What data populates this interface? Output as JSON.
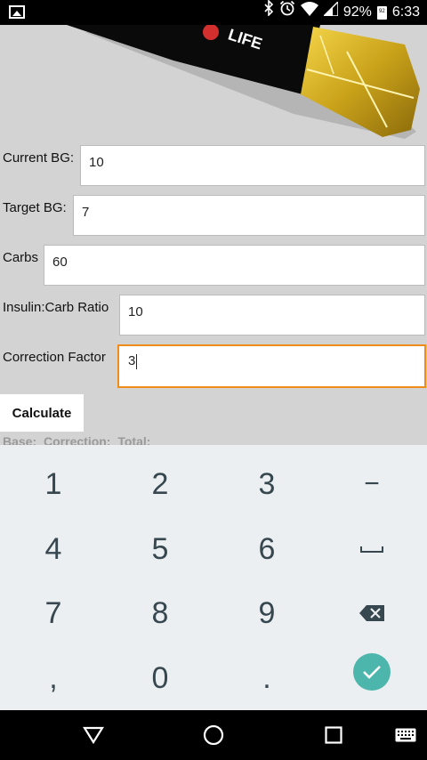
{
  "status_bar": {
    "battery_percent": "92%",
    "sim_badge": "92",
    "time": "6:33",
    "icons": [
      "gallery-icon",
      "bluetooth-icon",
      "alarm-icon",
      "wifi-icon",
      "signal-icon",
      "battery-icon"
    ]
  },
  "banner": {
    "logo_text": "LIFE"
  },
  "form": {
    "current_bg": {
      "label": "Current BG:",
      "value": "10"
    },
    "target_bg": {
      "label": "Target BG:",
      "value": "7"
    },
    "carbs": {
      "label": "Carbs",
      "value": "60"
    },
    "ratio": {
      "label": "Insulin:Carb Ratio",
      "value": "10"
    },
    "correction": {
      "label": "Correction Factor",
      "value": "3"
    }
  },
  "calculate_label": "Calculate",
  "results_text": "Base: Correction: Total:",
  "keyboard": {
    "keys": [
      "1",
      "2",
      "3",
      "−",
      "4",
      "5",
      "6",
      "␣",
      "7",
      "8",
      "9",
      "⌫",
      ",",
      "0",
      ".",
      "✓"
    ]
  },
  "colors": {
    "accent": "#f08c1a",
    "keyboard_bg": "#eceff1",
    "done_button": "#4db6ac",
    "key_text": "#37474f"
  }
}
